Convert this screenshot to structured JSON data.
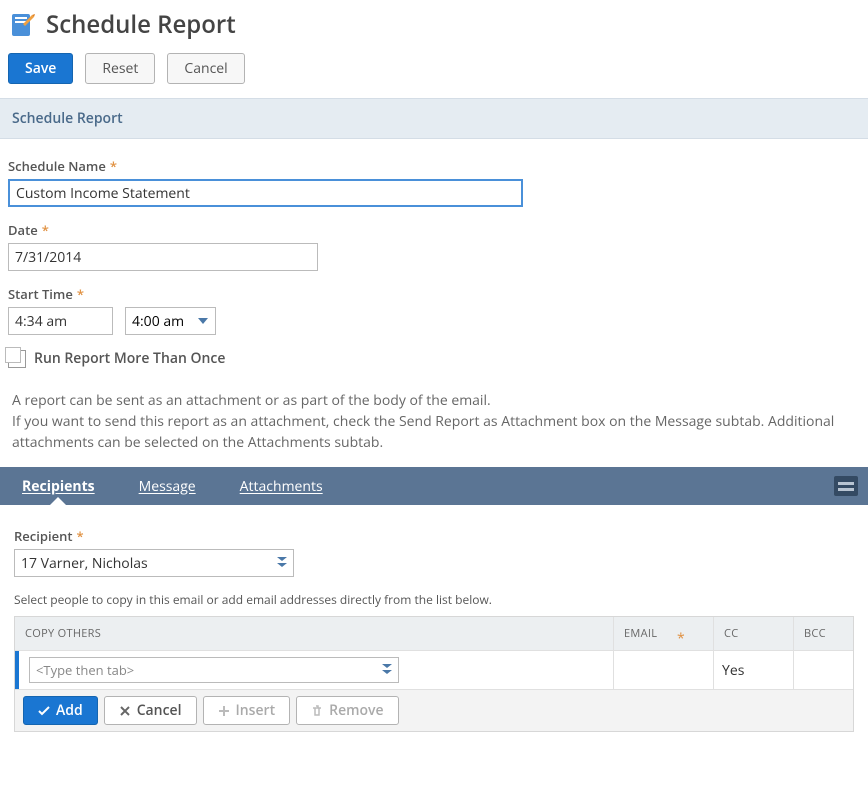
{
  "page": {
    "title": "Schedule Report"
  },
  "toolbar": {
    "save": "Save",
    "reset": "Reset",
    "cancel": "Cancel"
  },
  "section": {
    "title": "Schedule Report"
  },
  "fields": {
    "name": {
      "label": "Schedule Name",
      "value": "Custom Income Statement"
    },
    "date": {
      "label": "Date",
      "value": "7/31/2014"
    },
    "start": {
      "label": "Start Time",
      "value": "4:34 am",
      "dropdown": "4:00 am"
    },
    "repeat": {
      "label": "Run Report More Than Once"
    }
  },
  "help": {
    "line1": "A report can be sent as an attachment or as part of the body of the email.",
    "line2": "If you want to send this report as an attachment, check the Send Report as Attachment box on the Message subtab. Additional attachments can be selected on the Attachments subtab."
  },
  "tabs": {
    "recipients": "Recipients",
    "message": "Message",
    "attachments": "Attachments"
  },
  "recipient": {
    "label": "Recipient",
    "value": "17 Varner, Nicholas",
    "hint": "Select people to copy in this email or add email addresses directly from the list below."
  },
  "grid": {
    "headers": {
      "copy": "COPY OTHERS",
      "email": "EMAIL",
      "cc": "CC",
      "bcc": "BCC"
    },
    "row": {
      "placeholder": "<Type then tab>",
      "cc": "Yes"
    },
    "actions": {
      "add": "Add",
      "cancel": "Cancel",
      "insert": "Insert",
      "remove": "Remove"
    }
  }
}
